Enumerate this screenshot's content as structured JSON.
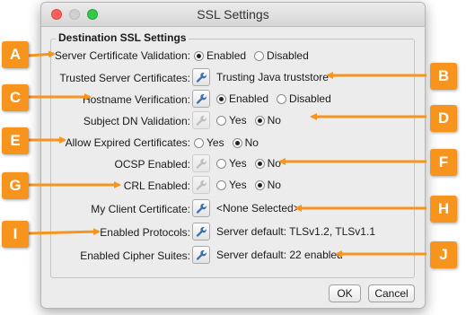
{
  "window": {
    "title": "SSL Settings"
  },
  "group": {
    "title": "Destination SSL Settings"
  },
  "rows": {
    "server_cert_validation": {
      "label": "Server Certificate Validation:",
      "opt1": "Enabled",
      "opt2": "Disabled",
      "selected": "Enabled"
    },
    "trusted_server_certs": {
      "label": "Trusted Server Certificates:",
      "value": "Trusting Java truststore"
    },
    "hostname_verification": {
      "label": "Hostname Verification:",
      "opt1": "Enabled",
      "opt2": "Disabled",
      "selected": "Enabled"
    },
    "subject_dn_validation": {
      "label": "Subject DN Validation:",
      "opt1": "Yes",
      "opt2": "No",
      "selected": "No"
    },
    "allow_expired_certs": {
      "label": "Allow Expired Certificates:",
      "opt1": "Yes",
      "opt2": "No",
      "selected": "No"
    },
    "ocsp_enabled": {
      "label": "OCSP Enabled:",
      "opt1": "Yes",
      "opt2": "No",
      "selected": "No"
    },
    "crl_enabled": {
      "label": "CRL Enabled:",
      "opt1": "Yes",
      "opt2": "No",
      "selected": "No"
    },
    "my_client_cert": {
      "label": "My Client Certificate:",
      "value": "<None Selected>"
    },
    "enabled_protocols": {
      "label": "Enabled Protocols:",
      "value": "Server default: TLSv1.2, TLSv1.1"
    },
    "enabled_cipher_suites": {
      "label": "Enabled Cipher Suites:",
      "value": "Server default: 22 enabled"
    }
  },
  "buttons": {
    "ok": "OK",
    "cancel": "Cancel"
  },
  "callouts": [
    "A",
    "B",
    "C",
    "D",
    "E",
    "F",
    "G",
    "H",
    "I",
    "J"
  ],
  "colors": {
    "callout": "#f7941d",
    "close": "#fc605b",
    "maximize": "#34c84a"
  },
  "icons": {
    "edit": "wrench-icon"
  }
}
